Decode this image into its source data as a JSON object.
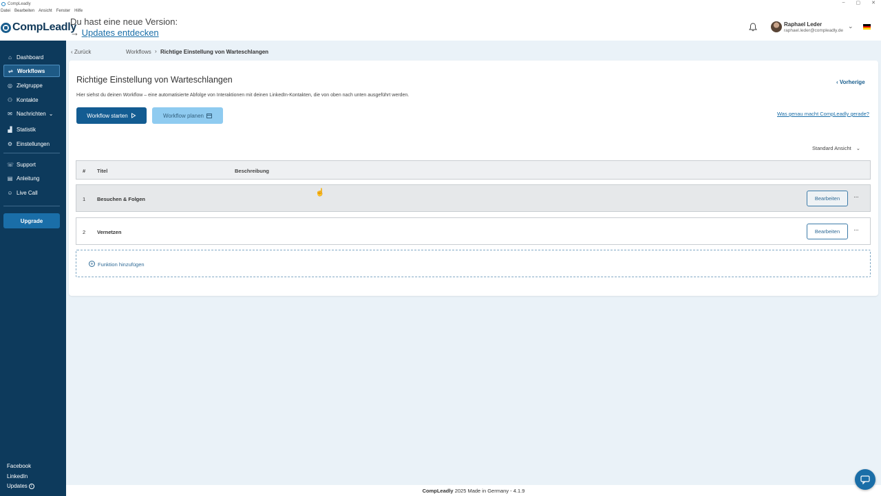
{
  "window": {
    "title": "CompLeadly",
    "controls": [
      "–",
      "▢",
      "✕"
    ]
  },
  "menubar": [
    "Datei",
    "Bearbeiten",
    "Ansicht",
    "Fenster",
    "Hilfe"
  ],
  "header": {
    "logo": "CompLeadly",
    "update_line": "Du hast eine neue Version:",
    "update_arrow": "→",
    "update_link": "Updates entdecken",
    "user_name": "Raphael Leder",
    "user_email": "raphael.leder@compleadly.de",
    "colors": {
      "brand": "#123a5a",
      "link": "#1a6ea8"
    }
  },
  "sidebar": {
    "items": [
      {
        "label": "Dashboard",
        "icon": "dashboard-icon"
      },
      {
        "label": "Workflows",
        "icon": "workflow-icon",
        "active": true
      },
      {
        "label": "Zielgruppe",
        "icon": "target-icon"
      },
      {
        "label": "Kontakte",
        "icon": "users-icon"
      },
      {
        "label": "Nachrichten",
        "icon": "chat-icon"
      },
      {
        "label": "Statistik",
        "icon": "chart-icon"
      },
      {
        "label": "Einstellungen",
        "icon": "gear-icon"
      }
    ],
    "support_items": [
      {
        "label": "Support",
        "icon": "support-icon"
      },
      {
        "label": "Anleitung",
        "icon": "book-icon"
      },
      {
        "label": "Live Call",
        "icon": "person-icon"
      }
    ],
    "upgrade": "Upgrade",
    "footer_links": [
      "Facebook",
      "LinkedIn",
      "Updates"
    ],
    "colors": {
      "background": "#0d3a5c",
      "upgrade": "#1a6ea8"
    }
  },
  "breadcrumb": {
    "back": "Zurück",
    "parent": "Workflows",
    "current": "Richtige Einstellung von Warteschlangen"
  },
  "main": {
    "title": "Richtige Einstellung von Warteschlangen",
    "previous": "Vorherige",
    "description": "Hier siehst du deinen Workflow – eine automatisierte Abfolge von Interaktionen mit deinen LinkedIn-Kontakten, die von oben nach unten ausgeführt werden.",
    "start_button": "Workflow starten",
    "plan_button": "Workflow planen",
    "help_link": "Was genau macht CompLeadly gerade?",
    "view_select": "Standard Ansicht",
    "table": {
      "headers": [
        "#",
        "Titel",
        "Beschreibung"
      ],
      "rows": [
        {
          "num": "1",
          "title": "Besuchen & Folgen",
          "action": "Bearbeiten",
          "more": "···"
        },
        {
          "num": "2",
          "title": "Vernetzen",
          "action": "Bearbeiten",
          "more": "···"
        }
      ]
    },
    "add_function": "Funktion hinzufügen"
  },
  "footer": {
    "brand": "CompLeadly",
    "text": "2025 Made in Germany - 4.1.9"
  }
}
